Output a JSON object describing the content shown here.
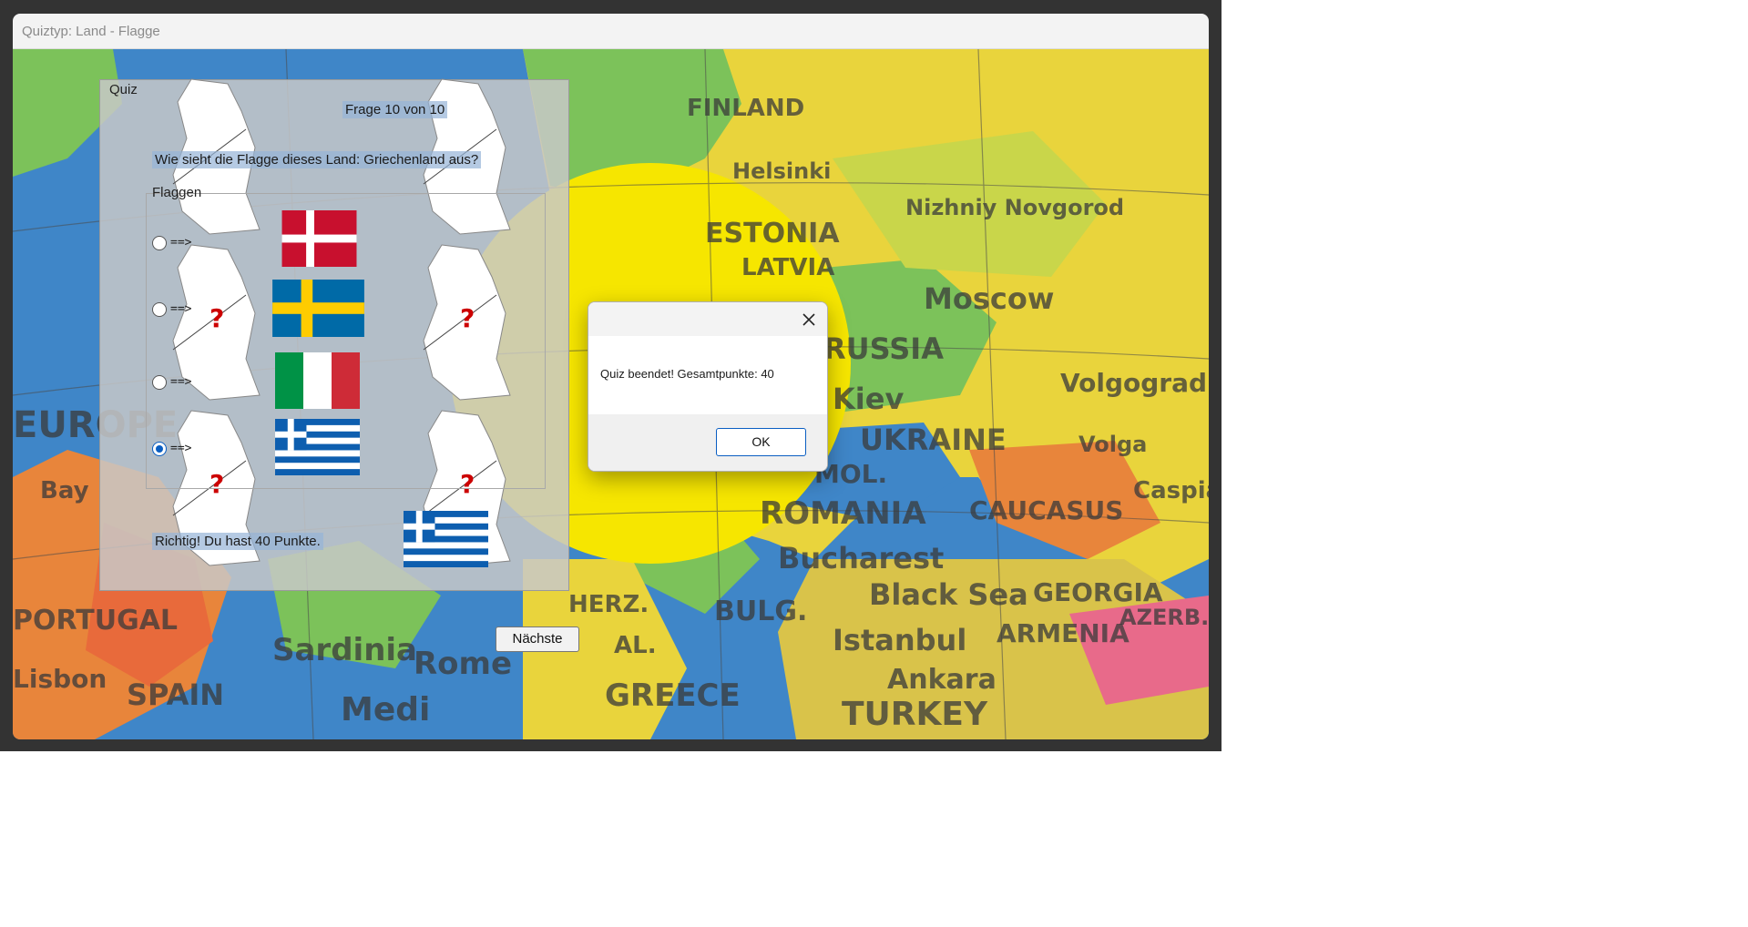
{
  "window": {
    "title": "Quiztyp: Land - Flagge"
  },
  "map": {
    "labels": [
      "FINLAND",
      "Helsinki",
      "ESTONIA",
      "LATVIA",
      "Nizhniy Novgorod",
      "Moscow",
      "RUSSIA",
      "Kiev",
      "UKRAINE",
      "Volgograd",
      "Volga",
      "MOL.",
      "ROMANIA",
      "Bucharest",
      "CAUCASUS",
      "Black Sea",
      "Caspian Sea",
      "GEORGIA",
      "ARMENIA",
      "AZERB.",
      "BULG.",
      "Istanbul",
      "Ankara",
      "TURKEY",
      "GREECE",
      "HERZ.",
      "AL.",
      "Sardinia",
      "Rome",
      "Medi",
      "SPAIN",
      "PORTUGAL",
      "Lisbon",
      "EUROPE",
      "Bay"
    ],
    "colors": {
      "ocean": "#3f86c8",
      "land_yellow": "#e9d43c",
      "land_green": "#7cc25a",
      "land_orange": "#e8853b"
    }
  },
  "quiz": {
    "panel_title": "Quiz",
    "counter": "Frage 10 von 10",
    "question": "Wie sieht die Flagge dieses Land: Griechenland aus?",
    "group_label": "Flaggen",
    "options": [
      {
        "arrow": "==>",
        "flag": "Denmark",
        "selected": false
      },
      {
        "arrow": "==>",
        "flag": "Sweden",
        "selected": false
      },
      {
        "arrow": "==>",
        "flag": "Italy",
        "selected": false
      },
      {
        "arrow": "==>",
        "flag": "Greece",
        "selected": true
      }
    ],
    "feedback": "Richtig! Du hast 40 Punkte.",
    "answer_flag": "Greece",
    "next_button": "Nächste"
  },
  "dialog": {
    "close_icon": "close-icon",
    "message": "Quiz beendet! Gesamtpunkte: 40",
    "ok_button": "OK"
  }
}
